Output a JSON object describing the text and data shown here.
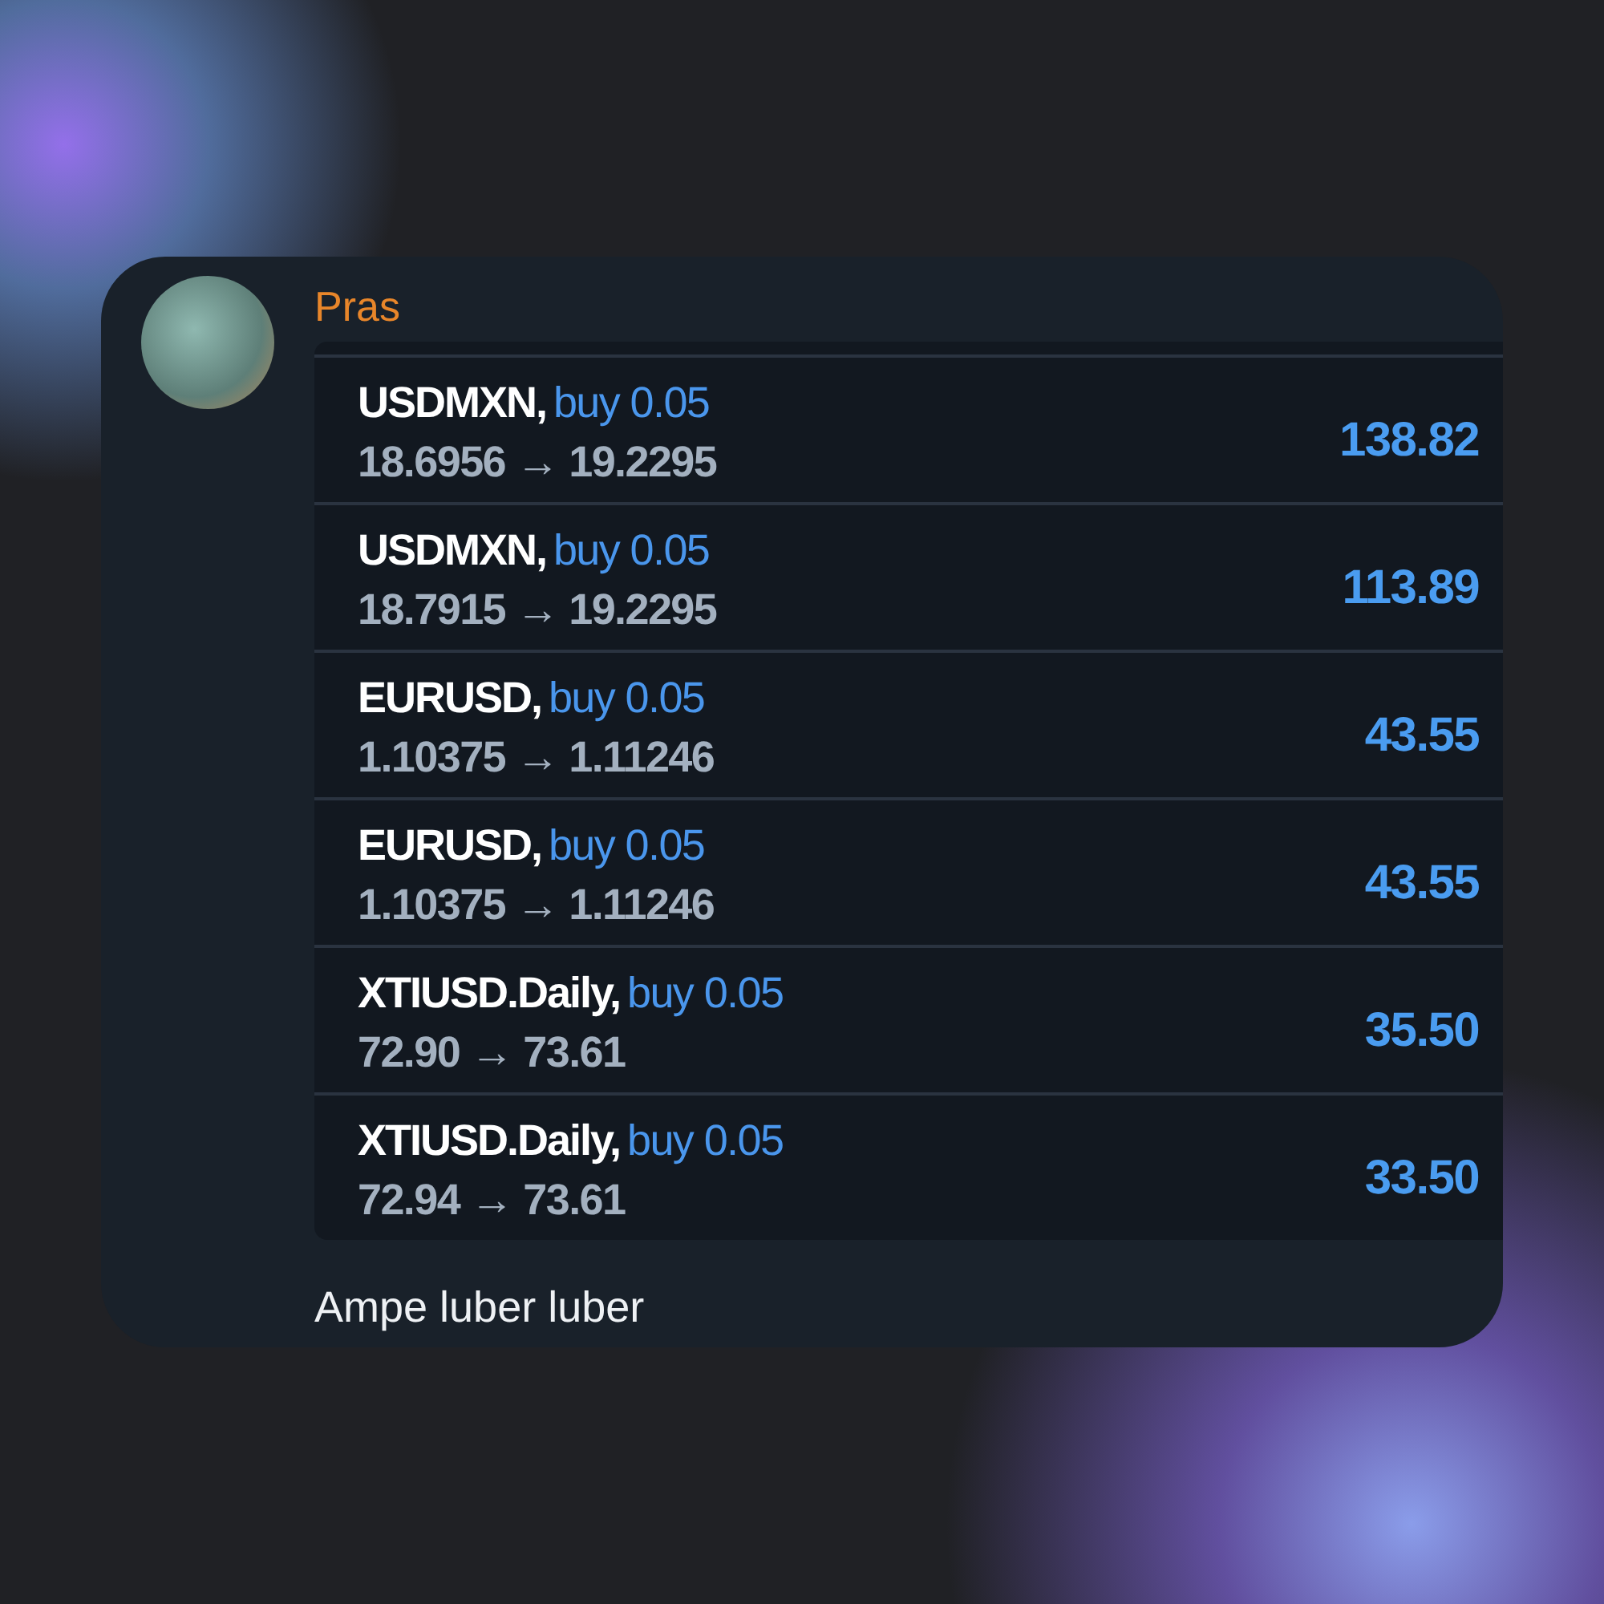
{
  "message": {
    "sender": "Pras",
    "trades": [
      {
        "symbol": "USDMXN,",
        "order": "buy 0.05",
        "prices": "18.6956 → 19.2295",
        "profit": "138.82"
      },
      {
        "symbol": "USDMXN,",
        "order": "buy 0.05",
        "prices": "18.7915 → 19.2295",
        "profit": "113.89"
      },
      {
        "symbol": "EURUSD,",
        "order": "buy 0.05",
        "prices": "1.10375 → 1.11246",
        "profit": "43.55"
      },
      {
        "symbol": "EURUSD,",
        "order": "buy 0.05",
        "prices": "1.10375 → 1.11246",
        "profit": "43.55"
      },
      {
        "symbol": "XTIUSD.Daily,",
        "order": "buy 0.05",
        "prices": "72.90 → 73.61",
        "profit": "35.50"
      },
      {
        "symbol": "XTIUSD.Daily,",
        "order": "buy 0.05",
        "prices": "72.94 → 73.61",
        "profit": "33.50"
      }
    ],
    "caption": "Ampe luber luber"
  }
}
